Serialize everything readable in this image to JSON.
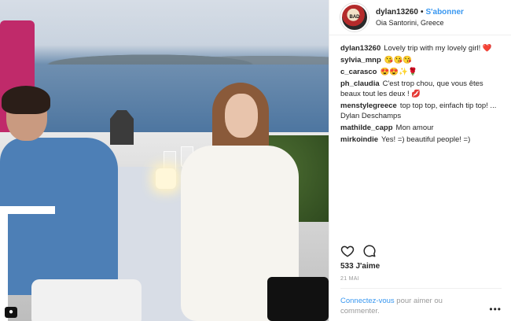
{
  "post": {
    "username": "dylan13260",
    "follow_label": "S'abonner",
    "separator": "•",
    "location": "Oia Santorini, Greece",
    "avatar_text": "BAD",
    "profile_icon": "person-icon",
    "caption_comment": {
      "user": "dylan13260",
      "text": "Lovely trip with my lovely girl! ❤️"
    },
    "comments": [
      {
        "user": "sylvia_mnp",
        "text": "😘😘😘"
      },
      {
        "user": "c_carasco",
        "text": "😍😍✨🌹"
      },
      {
        "user": "ph_claudia",
        "text": "C'est trop chou, que vous êtes beaux tout les deux ! 💋"
      },
      {
        "user": "menstylegreece",
        "text": "top top top, einfach tip top! ... Dylan Deschamps"
      },
      {
        "user": "mathilde_capp",
        "text": "Mon amour"
      },
      {
        "user": "mirkoindie",
        "text": "Yes! =) beautiful people! =)"
      }
    ],
    "likes": "533 J'aime",
    "date": "21 MAI",
    "login_link": "Connectez-vous",
    "login_rest": " pour aimer ou commenter.",
    "more": "•••",
    "accent": "#3897f0"
  }
}
